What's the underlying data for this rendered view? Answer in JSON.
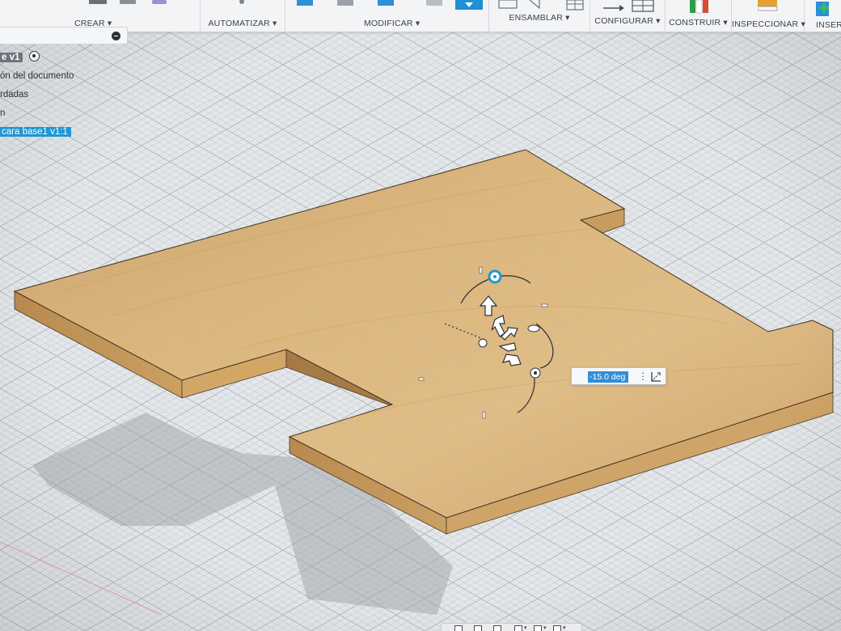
{
  "toolbar": {
    "groups": [
      {
        "id": "crear",
        "label": "CREAR ▾"
      },
      {
        "id": "automatizar",
        "label": "AUTOMATIZAR ▾"
      },
      {
        "id": "modificar",
        "label": "MODIFICAR ▾"
      },
      {
        "id": "ensamblar",
        "label": "ENSAMBLAR ▾"
      },
      {
        "id": "configurar",
        "label": "CONFIGURAR ▾"
      },
      {
        "id": "construir",
        "label": "CONSTRUIR ▾"
      },
      {
        "id": "inspeccionar",
        "label": "INSPECCIONAR ▾"
      },
      {
        "id": "insertar",
        "label": "INSERTA"
      }
    ]
  },
  "browser": {
    "component": "e v1",
    "rows": [
      {
        "label": "ón del documento"
      },
      {
        "label": "rdadas"
      },
      {
        "label": "n"
      },
      {
        "label": "cara base1 v1:1"
      }
    ]
  },
  "manipulator": {
    "angle_value": "-15.0 deg"
  },
  "colors": {
    "wood_top": "#d6ae72",
    "wood_side": "#c89a5c",
    "grid_bg": "#e4e7ea",
    "accent_blue": "#1e96d2",
    "selection_blue": "#2f8fd8"
  },
  "icons": [
    "collapse-icon",
    "radio-icon",
    "menu-dots-icon",
    "axis-icon"
  ]
}
